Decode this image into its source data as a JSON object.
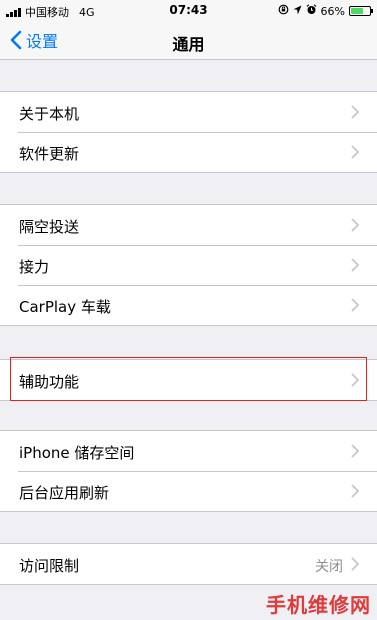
{
  "status_bar": {
    "carrier": "中国移动",
    "network": "4G",
    "time": "07:43",
    "battery_label": "66%",
    "battery_level": 0.66,
    "battery_color": "#4cd964",
    "icons": [
      "signal-icon",
      "orientation-lock-icon",
      "location-icon",
      "alarm-icon",
      "battery-icon"
    ]
  },
  "nav": {
    "back_label": "设置",
    "title": "通用",
    "accent": "#007aff"
  },
  "groups": [
    {
      "items": [
        {
          "label": "关于本机"
        },
        {
          "label": "软件更新"
        }
      ]
    },
    {
      "items": [
        {
          "label": "隔空投送"
        },
        {
          "label": "接力"
        },
        {
          "label": "CarPlay 车载"
        }
      ]
    },
    {
      "items": [
        {
          "label": "辅助功能"
        }
      ]
    },
    {
      "items": [
        {
          "label": "iPhone 储存空间"
        },
        {
          "label": "后台应用刷新"
        }
      ]
    },
    {
      "items": [
        {
          "label": "访问限制",
          "value": "关闭"
        }
      ]
    }
  ],
  "highlight_color": "#e02222",
  "watermark": "手机维修网"
}
